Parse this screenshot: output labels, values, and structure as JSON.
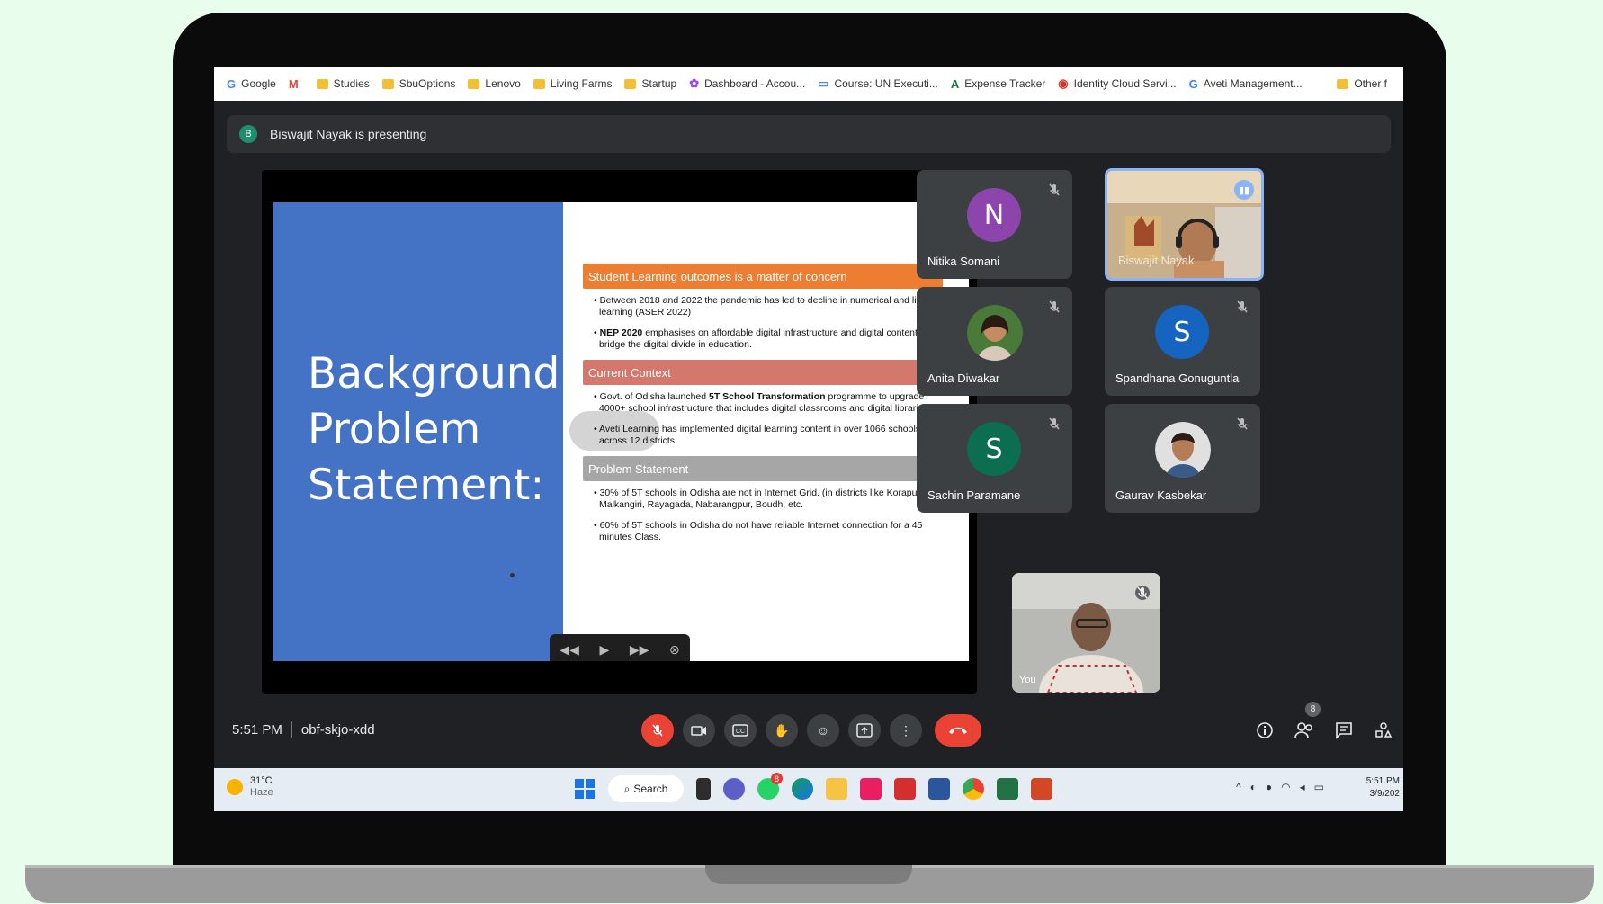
{
  "bookmarks": {
    "items": [
      {
        "label": "Google",
        "icon": "google-g-icon",
        "color": "#4285f4",
        "glyph": "G"
      },
      {
        "label": "",
        "icon": "gmail-icon",
        "color": "#ea4335",
        "glyph": "M"
      },
      {
        "label": "Studies",
        "icon": "folder-icon"
      },
      {
        "label": "SbuOptions",
        "icon": "folder-icon"
      },
      {
        "label": "Lenovo",
        "icon": "folder-icon"
      },
      {
        "label": "Living Farms",
        "icon": "folder-icon"
      },
      {
        "label": "Startup",
        "icon": "folder-icon"
      },
      {
        "label": "Dashboard - Accou...",
        "icon": "dashboard-icon",
        "color": "#a142f4",
        "glyph": "✿"
      },
      {
        "label": "Course: UN Executi...",
        "icon": "course-icon",
        "color": "#4a90e2",
        "glyph": "▭"
      },
      {
        "label": "Expense Tracker",
        "icon": "expense-tracker-icon",
        "color": "#0f7b3e",
        "glyph": "A"
      },
      {
        "label": "Identity Cloud Servi...",
        "icon": "identity-cloud-icon",
        "color": "#d93025",
        "glyph": "◉"
      },
      {
        "label": "Aveti Management...",
        "icon": "google-g-icon",
        "color": "#4285f4",
        "glyph": "G"
      }
    ],
    "other_label": "Other f"
  },
  "presenting": {
    "avatar_letter": "B",
    "text": "Biswajit Nayak is presenting"
  },
  "slide": {
    "title_lines": [
      "Background",
      "Problem",
      "Statement:"
    ],
    "sections": [
      {
        "heading": "Student Learning outcomes is a matter of concern",
        "style": "orange",
        "bullets": [
          {
            "pre": "",
            "bold": "",
            "text": "Between 2018 and 2022 the pandemic has led to decline in numerical and literacy learning (ASER 2022)"
          },
          {
            "pre": "",
            "bold": "NEP 2020",
            "text": " emphasises on affordable digital infrastructure and digital content to bridge the digital divide in education."
          }
        ]
      },
      {
        "heading": "Current Context",
        "style": "rose",
        "bullets": [
          {
            "pre": "Govt. of Odisha launched ",
            "bold": "5T School Transformation",
            "text": " programme to upgrade 4000+ school infrastructure that includes digital classrooms and digital libraries."
          },
          {
            "pre": "",
            "bold": "",
            "text": "Aveti Learning has implemented digital learning content in over 1066 schools across 12 districts"
          }
        ]
      },
      {
        "heading": "Problem Statement",
        "style": "gray",
        "bullets": [
          {
            "pre": "",
            "bold": "",
            "text": "30% of 5T schools in Odisha  are not in Internet Grid. (in districts like Koraput, Malkangiri, Rayagada, Nabarangpur, Boudh, etc."
          },
          {
            "pre": "",
            "bold": "",
            "text": "60% of 5T schools in Odisha  do not have reliable Internet connection for a 45 minutes Class."
          }
        ]
      }
    ],
    "controls": [
      "◀◀",
      "▶",
      "▶▶",
      "⊗"
    ]
  },
  "participants": {
    "nitika": {
      "name": "Nitika Somani",
      "letter": "N",
      "color": "#8e44ad"
    },
    "biswajit": {
      "name": "Biswajit Nayak"
    },
    "anita": {
      "name": "Anita Diwakar"
    },
    "spandhana": {
      "name": "Spandhana Gonuguntla",
      "letter": "S",
      "color": "#1565c0"
    },
    "sachin": {
      "name": "Sachin Paramane",
      "letter": "S",
      "color": "#0b6e4f"
    },
    "gaurav": {
      "name": "Gaurav Kasbekar"
    },
    "self": {
      "name": "You"
    }
  },
  "meeting": {
    "time": "5:51 PM",
    "code": "obf-skjo-xdd",
    "participant_count": "8"
  },
  "taskbar": {
    "weather_temp": "31°C",
    "weather_cond": "Haze",
    "search_label": "Search",
    "notification_badge": "8",
    "clock_time": "5:51 PM",
    "clock_date": "3/9/202"
  }
}
